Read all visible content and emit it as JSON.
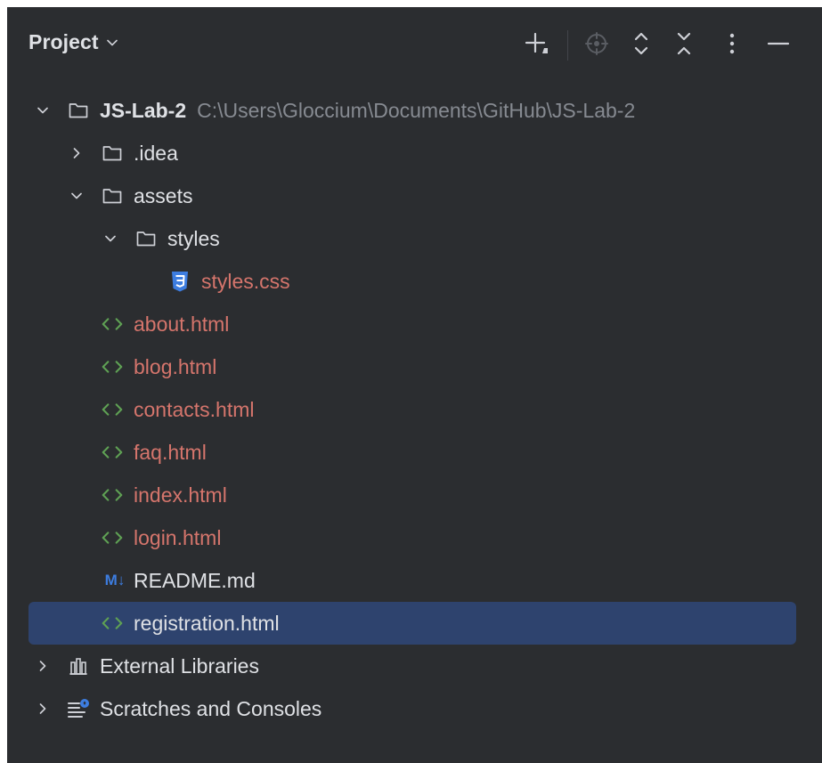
{
  "colors": {
    "panel_bg": "#2b2d30",
    "text": "#dfe1e5",
    "modified_text": "#d5756c",
    "muted_text": "#868a91",
    "html_icon": "#5fa154",
    "css_icon": "#3d7de0",
    "md_icon": "#3d7de0",
    "selection_bg": "#2e436e"
  },
  "header": {
    "title": "Project",
    "toolbar": [
      {
        "icon": "new-file-icon"
      },
      {
        "icon": "locate-icon"
      },
      {
        "icon": "expand-all-icon"
      },
      {
        "icon": "collapse-all-icon"
      },
      {
        "icon": "more-options-icon"
      },
      {
        "icon": "hide-icon"
      }
    ]
  },
  "tree": {
    "root": {
      "label": "JS-Lab-2",
      "path": "C:\\Users\\Gloccium\\Documents\\GitHub\\JS-Lab-2",
      "expanded": true
    },
    "idea": {
      "label": ".idea",
      "expanded": false
    },
    "assets": {
      "label": "assets",
      "expanded": true
    },
    "styles_dir": {
      "label": "styles",
      "expanded": true
    },
    "styles_css": {
      "label": "styles.css"
    },
    "about": {
      "label": "about.html"
    },
    "blog": {
      "label": "blog.html"
    },
    "contacts": {
      "label": "contacts.html"
    },
    "faq": {
      "label": "faq.html"
    },
    "index": {
      "label": "index.html"
    },
    "login": {
      "label": "login.html"
    },
    "readme": {
      "label": "README.md",
      "icon_text": "M↓"
    },
    "registration": {
      "label": "registration.html",
      "selected": true
    },
    "external": {
      "label": "External Libraries",
      "expanded": false
    },
    "scratches": {
      "label": "Scratches and Consoles",
      "expanded": false
    }
  }
}
